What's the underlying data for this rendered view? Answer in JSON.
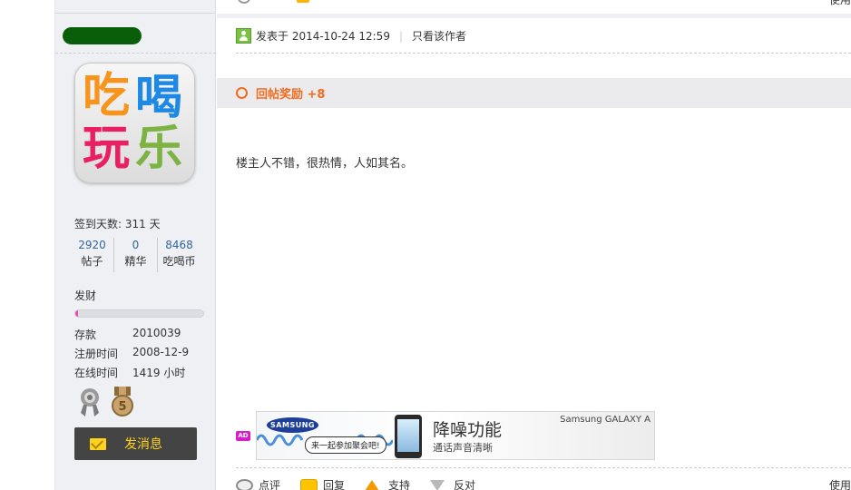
{
  "sidebar": {
    "avatar_chars": [
      "吃",
      "喝",
      "玩",
      "乐"
    ],
    "sign_days": "签到天数: 311 天",
    "stats": [
      {
        "value": "2920",
        "label": "帖子"
      },
      {
        "value": "0",
        "label": "精华"
      },
      {
        "value": "8468",
        "label": "吃喝币"
      }
    ],
    "group": "发财",
    "level_progress": 0.02,
    "info": [
      {
        "key": "存款",
        "value": "2010039"
      },
      {
        "key": "注册时间",
        "value": "2008-12-9"
      },
      {
        "key": "在线时间",
        "value": "1419 小时"
      }
    ],
    "medals": [
      "award-medal-icon",
      "medal-5-icon"
    ],
    "pm_button": "发消息"
  },
  "post": {
    "top_right_cut": "使用",
    "posted_at": "发表于 2014-10-24 12:59",
    "only_author": "只看该作者",
    "reward": "回帖奖励 +8",
    "body": "楼主人不错，很热情，人如其名。",
    "ad": {
      "tag": "AD",
      "logo": "SAMSUNG",
      "bubble": "来一起参加聚会吧!",
      "title": "降噪功能",
      "subtitle": "通话声音清晰",
      "brand": "Samsung GALAXY A"
    },
    "actions": [
      {
        "icon": "comment-icon",
        "label": "点评"
      },
      {
        "icon": "reply-icon",
        "label": "回复"
      },
      {
        "icon": "thumbs-up-icon",
        "label": "支持"
      },
      {
        "icon": "thumbs-down-icon",
        "label": "反对"
      }
    ],
    "use_link": "使用"
  },
  "colors": {
    "sidebar_bg": "#eef0f4",
    "link_blue": "#336699",
    "reward_orange": "#f26c1f",
    "username_green": "#0a5e0a",
    "level_pink": "#e94ba0"
  }
}
